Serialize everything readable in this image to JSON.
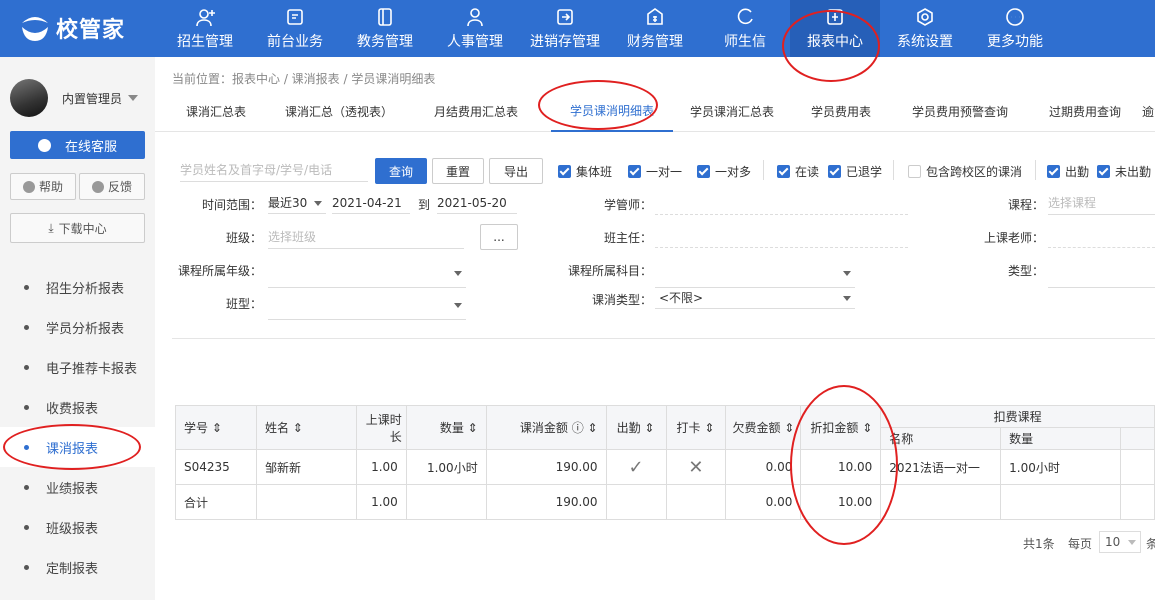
{
  "brand": {
    "name": "校管家"
  },
  "nav": [
    {
      "label": "招生管理",
      "icon": "user-add-icon"
    },
    {
      "label": "前台业务",
      "icon": "monitor-icon"
    },
    {
      "label": "教务管理",
      "icon": "book-icon"
    },
    {
      "label": "人事管理",
      "icon": "person-icon"
    },
    {
      "label": "进销存管理",
      "icon": "inventory-icon"
    },
    {
      "label": "财务管理",
      "icon": "finance-icon"
    },
    {
      "label": "师生信",
      "icon": "message-icon"
    },
    {
      "label": "报表中心",
      "icon": "report-icon"
    },
    {
      "label": "系统设置",
      "icon": "settings-icon"
    },
    {
      "label": "更多功能",
      "icon": "more-icon"
    }
  ],
  "sidebar": {
    "user": "内置管理员",
    "service": "在线客服",
    "help": "帮助",
    "feedback": "反馈",
    "download": "下载中心",
    "items": [
      "招生分析报表",
      "学员分析报表",
      "电子推荐卡报表",
      "收费报表",
      "课消报表",
      "业绩报表",
      "班级报表",
      "定制报表"
    ]
  },
  "breadcrumb": "当前位置：报表中心 / 课消报表 / 学员课消明细表",
  "tabs": [
    "课消汇总表",
    "课消汇总（透视表）",
    "月结费用汇总表",
    "学员课消明细表",
    "学员课消汇总表",
    "学员费用表",
    "学员费用预警查询",
    "过期费用查询",
    "逾"
  ],
  "filters": {
    "search_placeholder": "学员姓名及首字母/学号/电话",
    "query": "查询",
    "reset": "重置",
    "export": "导出",
    "checks": [
      "集体班",
      "一对一",
      "一对多",
      "在读",
      "已退学",
      "包含跨校区的课消",
      "出勤",
      "未出勤"
    ],
    "time_label": "时间范围：",
    "time_value": "最近30",
    "date_from": "2021-04-21",
    "date_to_label": "到",
    "date_to": "2021-05-20",
    "manager_label": "学管师：",
    "course_label": "课程：",
    "course_placeholder": "选择课程",
    "class_label": "班级：",
    "class_placeholder": "选择班级",
    "ellipsis": "...",
    "head_teacher_label": "班主任：",
    "teacher_label": "上课老师：",
    "grade_label": "课程所属年级：",
    "subject_label": "课程所属科目：",
    "type_label": "类型：",
    "class_type_label": "班型：",
    "consume_type_label": "课消类型：",
    "consume_type_value": "<不限>"
  },
  "table": {
    "headers": {
      "id": "学号",
      "name": "姓名",
      "duration": "上课时长",
      "qty": "数量",
      "amount": "课消金额",
      "attend": "出勤",
      "punch": "打卡",
      "owe": "欠费金额",
      "discount": "折扣金额",
      "deduct_group": "扣费课程",
      "deduct_name": "名称",
      "deduct_qty": "数量"
    },
    "rows": [
      {
        "id": "S04235",
        "name": "邹新新",
        "duration": "1.00",
        "qty": "1.00小时",
        "amount": "190.00",
        "attend": "✓",
        "punch": "✕",
        "owe": "0.00",
        "discount": "10.00",
        "deduct_name": "2021法语一对一",
        "deduct_qty": "1.00小时"
      },
      {
        "id": "合计",
        "name": "",
        "duration": "1.00",
        "qty": "",
        "amount": "190.00",
        "attend": "",
        "punch": "",
        "owe": "0.00",
        "discount": "10.00",
        "deduct_name": "",
        "deduct_qty": ""
      }
    ]
  },
  "pager": {
    "total": "共1条",
    "per_page_label": "每页",
    "per_page": "10",
    "suffix": "条"
  }
}
